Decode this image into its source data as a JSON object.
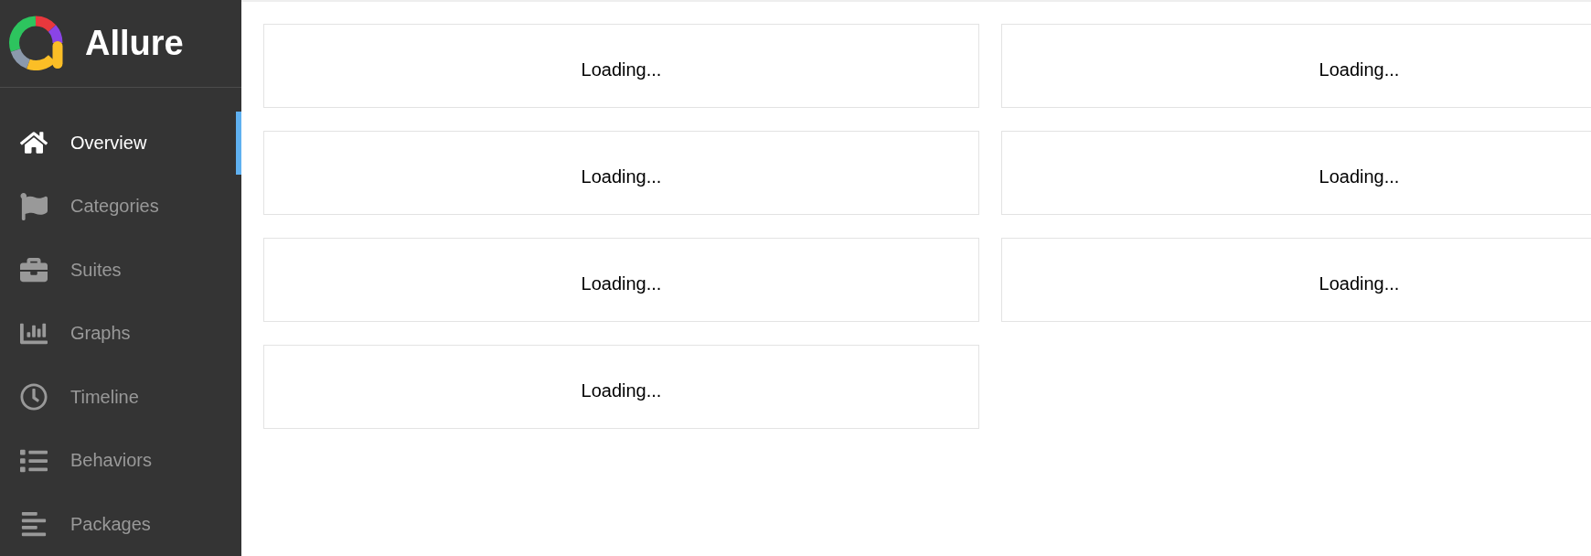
{
  "brand": {
    "title": "Allure"
  },
  "nav": [
    {
      "label": "Overview",
      "selected": true
    },
    {
      "label": "Categories",
      "selected": false
    },
    {
      "label": "Suites",
      "selected": false
    },
    {
      "label": "Graphs",
      "selected": false
    },
    {
      "label": "Timeline",
      "selected": false
    },
    {
      "label": "Behaviors",
      "selected": false
    },
    {
      "label": "Packages",
      "selected": false
    }
  ],
  "widgets": [
    {
      "text": "Loading..."
    },
    {
      "text": "Loading..."
    },
    {
      "text": "Loading..."
    },
    {
      "text": "Loading..."
    },
    {
      "text": "Loading..."
    },
    {
      "text": "Loading..."
    },
    {
      "text": "Loading..."
    }
  ]
}
